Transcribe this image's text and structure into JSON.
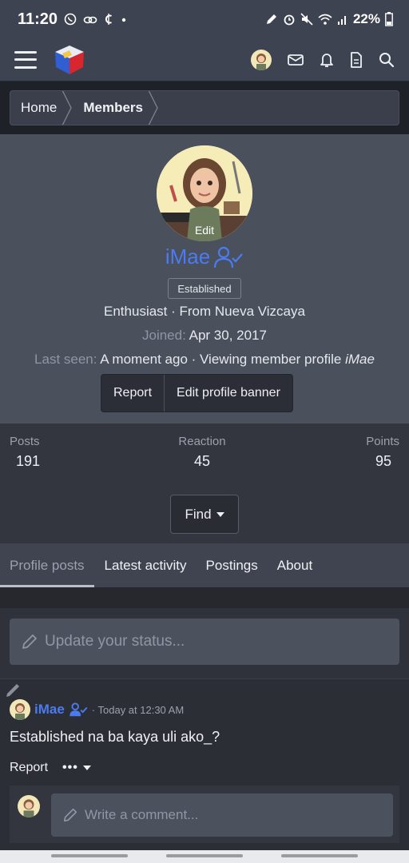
{
  "status_bar": {
    "time": "11:20",
    "battery": "22%",
    "left_icons": [
      "whatsapp-icon",
      "link-icon",
      "currency-icon",
      "dot-icon"
    ],
    "right_icons": [
      "pen-icon",
      "alarm-icon",
      "mute-icon",
      "wifi-icon",
      "signal-icon",
      "battery-icon"
    ]
  },
  "nav": {
    "icons": [
      "menu-icon",
      "site-logo",
      "user-avatar",
      "envelope-icon",
      "bell-icon",
      "document-icon",
      "search-icon"
    ]
  },
  "breadcrumb": {
    "items": [
      {
        "label": "Home",
        "bold": false
      },
      {
        "label": "Members",
        "bold": true
      }
    ]
  },
  "profile": {
    "avatar_edit": "Edit",
    "username": "iMae",
    "user_title": "Established",
    "line1": "Enthusiast · From Nueva Vizcaya",
    "joined_label": "Joined:",
    "joined_value": "Apr 30, 2017",
    "last_seen_label": "Last seen:",
    "last_seen_value": "A moment ago · Viewing member profile ",
    "last_seen_target": "iMae",
    "buttons": {
      "report": "Report",
      "edit_banner": "Edit profile banner"
    }
  },
  "stats": {
    "posts_label": "Posts",
    "posts_value": "191",
    "reaction_label": "Reaction",
    "reaction_value": "45",
    "points_label": "Points",
    "points_value": "95",
    "find_label": "Find"
  },
  "tabs": [
    {
      "label": "Profile posts",
      "active": true
    },
    {
      "label": "Latest activity",
      "active": false
    },
    {
      "label": "Postings",
      "active": false
    },
    {
      "label": "About",
      "active": false
    }
  ],
  "status_update": {
    "placeholder": "Update your status..."
  },
  "post": {
    "user": "iMae",
    "time": "· Today at 12:30 AM",
    "text": "Established na ba kaya uli ako_?",
    "report": "Report",
    "more": "•••",
    "comment_placeholder": "Write a comment..."
  },
  "colors": {
    "accent": "#4b7bf1",
    "navbar": "#3d4350",
    "profile_bg": "#4a505c",
    "page_bg": "#2b2d35"
  }
}
